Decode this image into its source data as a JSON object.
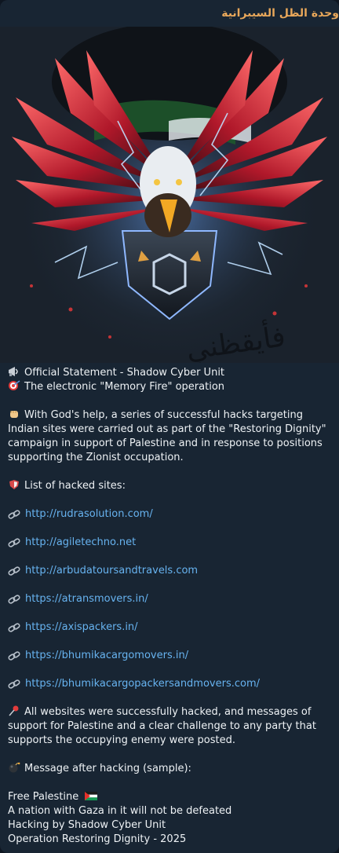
{
  "message": {
    "sender": "وحدة الظل السيبرانية",
    "photo": {
      "overlay_texts": [
        "فأيقظني"
      ]
    },
    "lines": {
      "statement_title": "Official Statement - Shadow Cyber Unit",
      "operation_title": "The electronic \"Memory Fire\" operation",
      "intro": "With God's help, a series of successful hacks targeting Indian sites were carried out as part of the \"Restoring Dignity\" campaign in support of Palestine and in response to positions supporting the Zionist occupation.",
      "list_header": "List of hacked sites:",
      "conclusion": "All websites were successfully hacked, and messages of support for Palestine and a clear challenge to any party that supports the occupying enemy were posted.",
      "sample_header": "Message after hacking (sample):",
      "sample_1": "Free Palestine",
      "sample_2": "A nation with Gaza in it will not be defeated",
      "sample_3": "Hacking by Shadow Cyber Unit",
      "sample_4": "Operation Restoring Dignity - 2025"
    },
    "links": [
      "http://rudrasolution.com/",
      "http://agiletechno.net",
      "http://arbudatoursandtravels.com",
      "https://atransmovers.in/",
      "https://axispackers.in/",
      "https://bhumikacargomovers.in/",
      "https://bhumikacargopackersandmovers.com/"
    ],
    "icons": {
      "statement": "megaphone-icon",
      "operation": "target-icon",
      "intro": "raised-fist-icon",
      "list": "shield-icon",
      "link": "link-icon",
      "conclusion": "pushpin-icon",
      "sample": "bomb-icon",
      "flag": "palestine-flag-icon"
    },
    "colors": {
      "bubble": "#182533",
      "sender": "#e8a75a",
      "link": "#67b3f0",
      "text": "#eef2f5"
    }
  }
}
